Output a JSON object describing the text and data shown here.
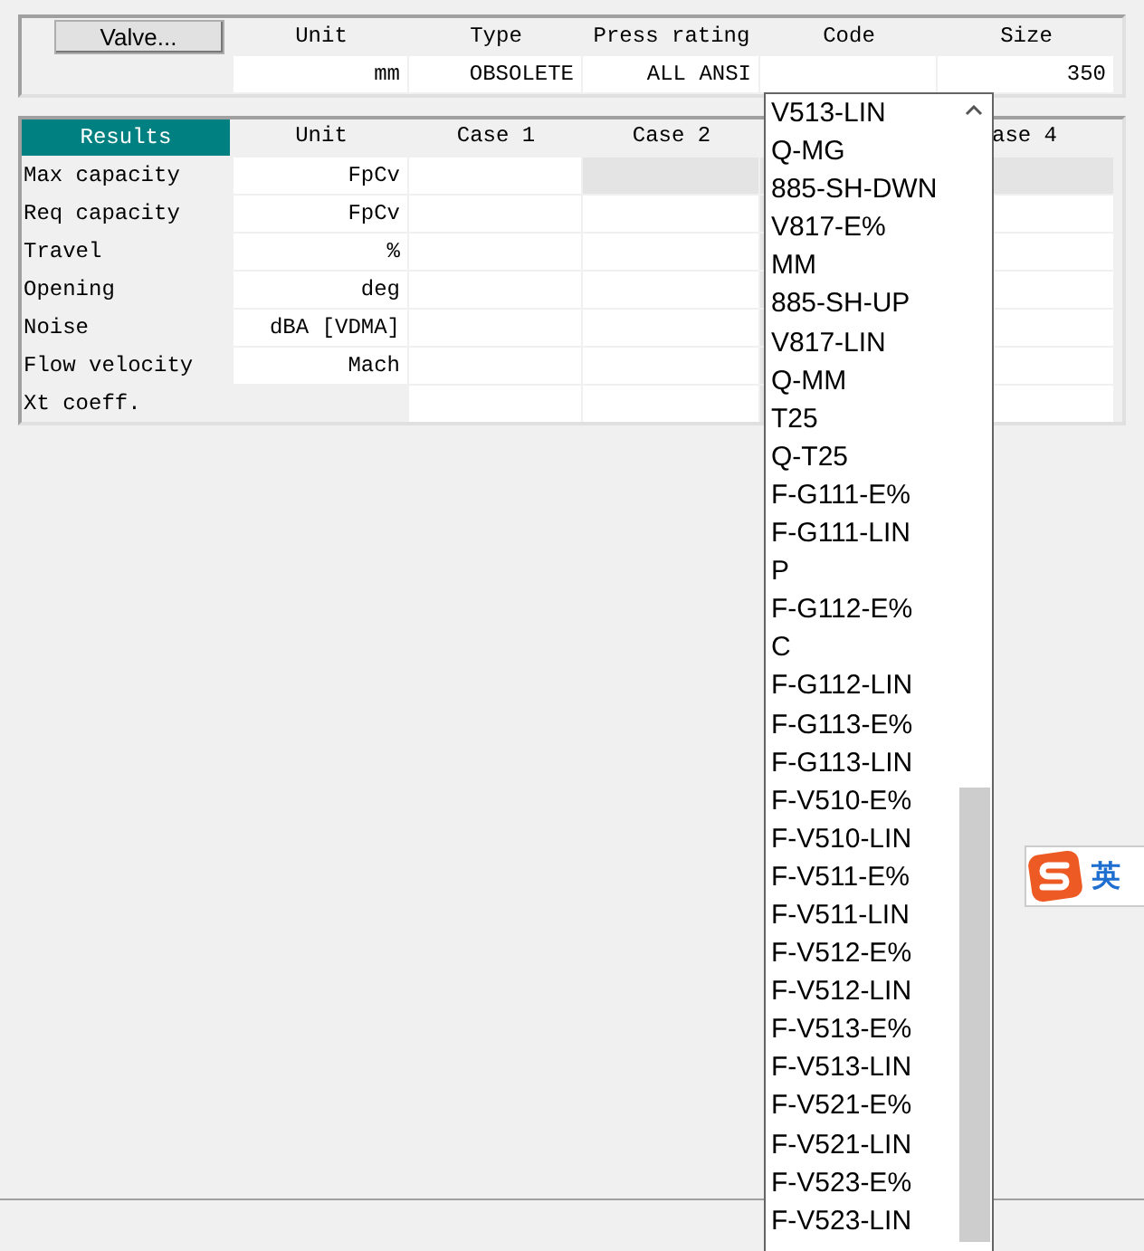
{
  "valve_panel": {
    "button": "Valve...",
    "columns": [
      "Unit",
      "Type",
      "Press rating",
      "Code",
      "Size"
    ],
    "values": {
      "unit": "mm",
      "type": "OBSOLETE",
      "press_rating": "ALL ANSI",
      "size": "350"
    }
  },
  "results": {
    "header": "Results",
    "columns": {
      "unit": "Unit",
      "case_1": "Case 1",
      "case_2": "Case 2",
      "case_4": "ase 4"
    },
    "rows": [
      {
        "label": "Max capacity",
        "unit": "FpCv",
        "case_1_enabled": true,
        "case_2_enabled": false,
        "case_4_enabled": false
      },
      {
        "label": "Req capacity",
        "unit": "FpCv",
        "case_1_enabled": true,
        "case_2_enabled": true,
        "case_4_enabled": true
      },
      {
        "label": "Travel",
        "unit": "%",
        "case_1_enabled": true,
        "case_2_enabled": true,
        "case_4_enabled": true
      },
      {
        "label": "Opening",
        "unit": "deg",
        "case_1_enabled": true,
        "case_2_enabled": true,
        "case_4_enabled": true
      },
      {
        "label": "Noise",
        "unit": "dBA [VDMA]",
        "case_1_enabled": true,
        "case_2_enabled": true,
        "case_4_enabled": true
      },
      {
        "label": "Flow velocity",
        "unit": "Mach",
        "case_1_enabled": true,
        "case_2_enabled": true,
        "case_4_enabled": true
      },
      {
        "label": "Xt coeff.",
        "case_1_enabled": true,
        "case_2_enabled": true,
        "case_4_enabled": true
      }
    ]
  },
  "code_dropdown": {
    "items": [
      "V513-LIN",
      "Q-MG",
      "885-SH-DWN",
      "V817-E%",
      "MM",
      "885-SH-UP",
      "V817-LIN",
      "Q-MM",
      "T25",
      "Q-T25",
      "F-G111-E%",
      "F-G111-LIN",
      "P",
      "F-G112-E%",
      "C",
      "F-G112-LIN",
      "F-G113-E%",
      "F-G113-LIN",
      "F-V510-E%",
      "F-V510-LIN",
      "F-V511-E%",
      "F-V511-LIN",
      "F-V512-E%",
      "F-V512-LIN",
      "F-V513-E%",
      "F-V513-LIN",
      "F-V521-E%",
      "F-V521-LIN",
      "F-V523-E%",
      "F-V523-LIN"
    ]
  },
  "ime": {
    "label": "英"
  }
}
